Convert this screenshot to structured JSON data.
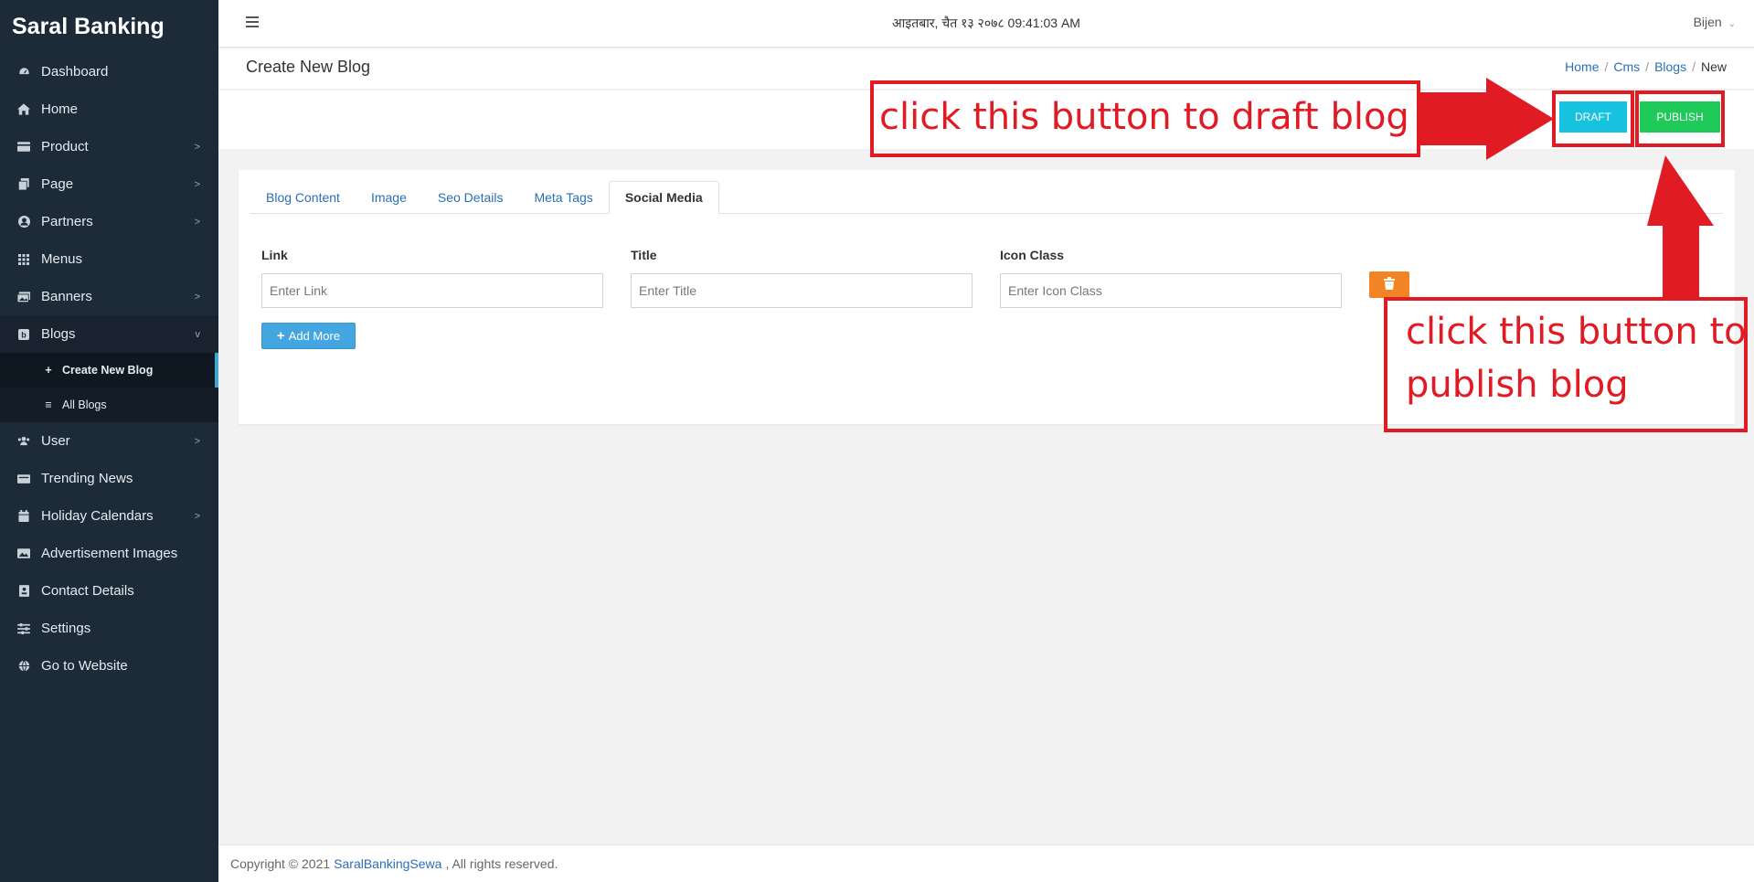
{
  "sidebar": {
    "brand": "Saral Banking",
    "items": [
      {
        "label": "Dashboard",
        "icon": "dashboard-icon",
        "chevron": false
      },
      {
        "label": "Home",
        "icon": "home-icon",
        "chevron": false
      },
      {
        "label": "Product",
        "icon": "product-icon",
        "chevron": true
      },
      {
        "label": "Page",
        "icon": "page-icon",
        "chevron": true
      },
      {
        "label": "Partners",
        "icon": "partners-icon",
        "chevron": true
      },
      {
        "label": "Menus",
        "icon": "menus-icon",
        "chevron": false
      },
      {
        "label": "Banners",
        "icon": "banners-icon",
        "chevron": true
      },
      {
        "label": "Blogs",
        "icon": "blogs-icon",
        "chevron": true
      },
      {
        "label": "User",
        "icon": "user-icon",
        "chevron": true
      },
      {
        "label": "Trending News",
        "icon": "news-icon",
        "chevron": false
      },
      {
        "label": "Holiday Calendars",
        "icon": "calendar-icon",
        "chevron": true
      },
      {
        "label": "Advertisement Images",
        "icon": "image-icon",
        "chevron": false
      },
      {
        "label": "Contact Details",
        "icon": "contact-icon",
        "chevron": false
      },
      {
        "label": "Settings",
        "icon": "settings-icon",
        "chevron": false
      },
      {
        "label": "Go to Website",
        "icon": "globe-icon",
        "chevron": false
      }
    ],
    "blogs_sub": [
      {
        "label": "Create New Blog",
        "icon": "plus-icon"
      },
      {
        "label": "All Blogs",
        "icon": "list-icon"
      }
    ]
  },
  "topbar": {
    "datetime": "आइतबार, चैत १३ २०७८ 09:41:03 AM",
    "user": "Bijen"
  },
  "page": {
    "title": "Create New Blog",
    "breadcrumb": [
      "Home",
      "Cms",
      "Blogs",
      "New"
    ]
  },
  "actions": {
    "draft": "DRAFT",
    "publish": "PUBLISH"
  },
  "tabs": [
    "Blog Content",
    "Image",
    "Seo Details",
    "Meta Tags",
    "Social Media"
  ],
  "active_tab": "Social Media",
  "form": {
    "link_label": "Link",
    "link_placeholder": "Enter Link",
    "title_label": "Title",
    "title_placeholder": "Enter Title",
    "icon_label": "Icon Class",
    "icon_placeholder": "Enter Icon Class",
    "add_more": "Add More"
  },
  "footer": {
    "prefix": "Copyright © 2021",
    "link": "SaralBankingSewa",
    "suffix": ", All rights reserved."
  },
  "annotations": {
    "draft_note": "click this button to draft blog",
    "publish_note_line1": "click this button to",
    "publish_note_line2": "publish blog",
    "color": "#e01b24"
  },
  "colors": {
    "sidebar_bg": "#1d2a38",
    "draft_btn": "#17c1e0",
    "publish_btn": "#1fc95a",
    "delete_btn": "#f28426",
    "add_btn": "#43a6e0",
    "link": "#2a6fb4"
  }
}
